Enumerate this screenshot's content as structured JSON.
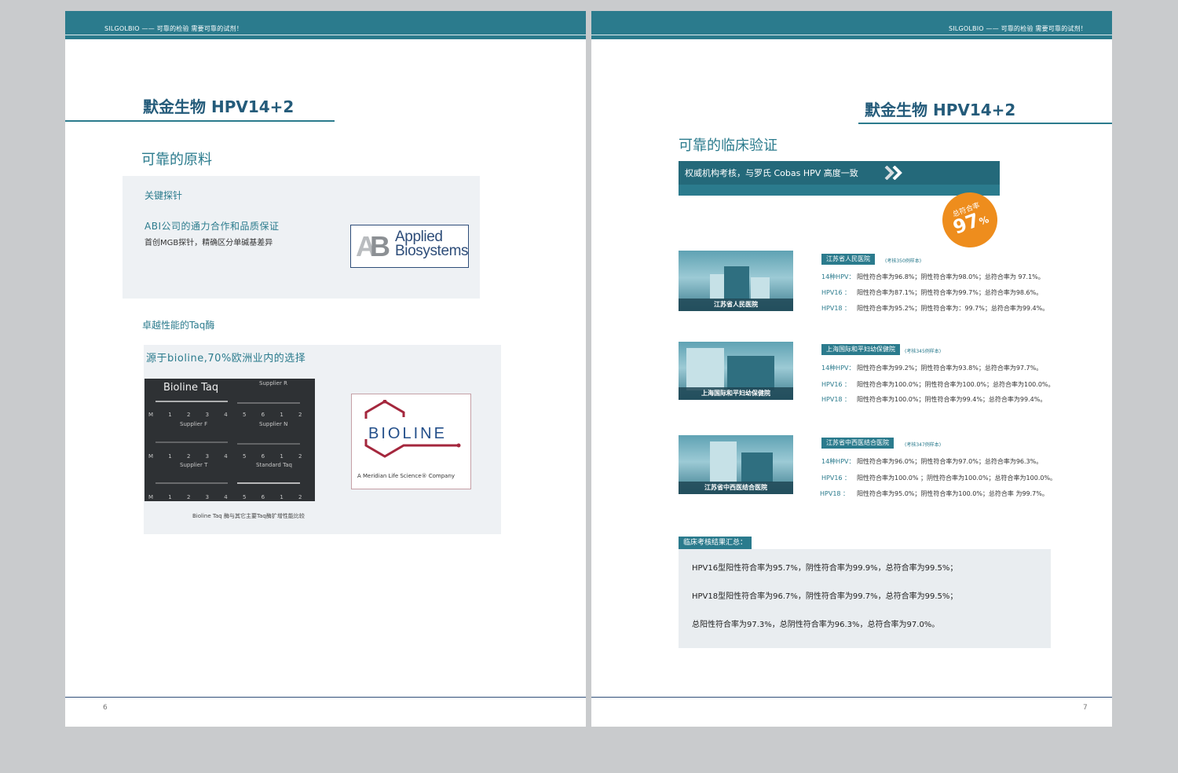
{
  "header": {
    "slogan": "SILGOLBIO —— 可靠的检验 需要可靠的试剂！"
  },
  "brand": "默金生物 HPV14+2",
  "left_page": {
    "page_number": "6",
    "section_title": "可靠的原料",
    "probe": {
      "title": "关键探针",
      "line1": "ABI公司的通力合作和品质保证",
      "line2": "首创MGB探针，精确区分单碱基差异",
      "logo_line1": "Applied",
      "logo_line2": "Biosystems"
    },
    "taq": {
      "title": "卓越性能的Taq酶",
      "subtitle": "源于bioline,70%欧洲业内的选择",
      "gel_title": "Bioline Taq",
      "gel_labels": [
        "Supplier R",
        "Supplier F",
        "Supplier N",
        "Supplier T",
        "Standard Taq"
      ],
      "lane_text": "M 1 2 3 4 5 6 1 2 3 4 5 6",
      "caption": "Bioline Taq 酶与其它主要Taq酶扩增性能比较",
      "bioline_name": "BIOLINE",
      "bioline_sub": "A Meridian Life Science® Company"
    }
  },
  "right_page": {
    "page_number": "7",
    "section_title": "可靠的临床验证",
    "banner": "权威机构考核，与罗氏 Cobas HPV 高度一致",
    "badge": {
      "label": "总符合率",
      "value": "97",
      "unit": "%"
    },
    "hospitals": [
      {
        "image_caption": "江苏省人民医院",
        "name": "江苏省人民医院",
        "note": "(考核350例样本)",
        "rows": [
          {
            "label": "14种HPV：",
            "value": "阳性符合率为96.8%；阴性符合率为98.0%；总符合率为 97.1%。"
          },
          {
            "label": "HPV16 ：",
            "value": "阳性符合率为87.1%；阴性符合率为99.7%；总符合率为98.6%。"
          },
          {
            "label": "HPV18 ：",
            "value": "阳性符合率为95.2%；阴性符合率为：99.7%；总符合率为99.4%。"
          }
        ]
      },
      {
        "image_caption": "上海国际和平妇幼保健院",
        "name": "上海国际和平妇幼保健院",
        "note": "(考核345例样本)",
        "rows": [
          {
            "label": "14种HPV：",
            "value": "阳性符合率为99.2%；阴性符合率为93.8%；总符合率为97.7%。"
          },
          {
            "label": "HPV16 ：",
            "value": "阳性符合率为100.0%；阴性符合率为100.0%；总符合率为100.0%。"
          },
          {
            "label": "HPV18 ：",
            "value": "阳性符合率为100.0%；阴性符合率为99.4%；总符合率为99.4%。"
          }
        ]
      },
      {
        "image_caption": "江苏省中西医结合医院",
        "name": "江苏省中西医结合医院",
        "note": "(考核347例样本)",
        "rows": [
          {
            "label": "14种HPV：",
            "value": "阳性符合率为96.0%；阴性符合率为97.0%；总符合率为96.3%。"
          },
          {
            "label": "HPV16 ：",
            "value": "阳性符合率为100.0% ；阴性符合率为100.0%；总符合率为100.0%。"
          },
          {
            "label": "HPV18 ：",
            "value": "阳性符合率为95.0%；阴性符合率为100.0%；总符合率 为99.7%。"
          }
        ]
      }
    ],
    "summary": {
      "tag": "临床考核结果汇总：",
      "lines": [
        "HPV16型阳性符合率为95.7%，阴性符合率为99.9%，总符合率为99.5%；",
        "HPV18型阳性符合率为96.7%，阴性符合率为99.7%，总符合率为99.5%；",
        "总阳性符合率为97.3%，总阴性符合率为96.3%，总符合率为97.0%。"
      ]
    }
  },
  "colors": {
    "teal": "#2b7b8d",
    "navy": "#245b7a",
    "orange": "#ee8d1d",
    "panel": "#eef1f4"
  }
}
